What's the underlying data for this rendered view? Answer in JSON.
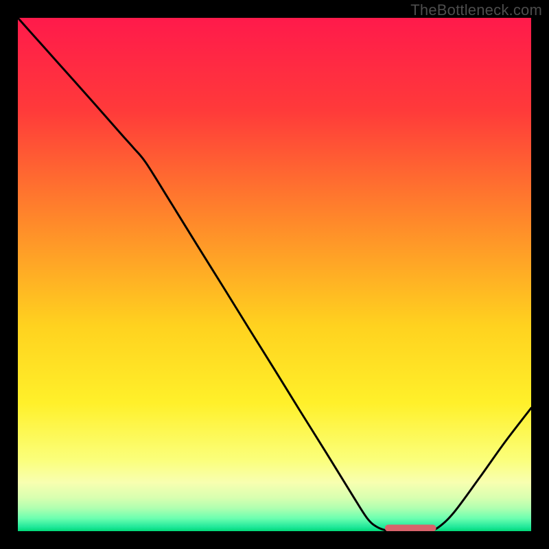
{
  "watermark": "TheBottleneck.com",
  "chart_data": {
    "type": "line",
    "title": "",
    "xlabel": "",
    "ylabel": "",
    "xlim": [
      0,
      100
    ],
    "ylim": [
      0,
      100
    ],
    "gradient_stops": [
      {
        "offset": 0.0,
        "color": "#ff1a4b"
      },
      {
        "offset": 0.18,
        "color": "#ff3a3a"
      },
      {
        "offset": 0.4,
        "color": "#ff8a2a"
      },
      {
        "offset": 0.6,
        "color": "#ffd21f"
      },
      {
        "offset": 0.75,
        "color": "#fff02a"
      },
      {
        "offset": 0.86,
        "color": "#fbff7a"
      },
      {
        "offset": 0.905,
        "color": "#f8ffb0"
      },
      {
        "offset": 0.935,
        "color": "#d8ffb0"
      },
      {
        "offset": 0.955,
        "color": "#b0ffb0"
      },
      {
        "offset": 0.975,
        "color": "#6cffb0"
      },
      {
        "offset": 0.992,
        "color": "#20e89a"
      },
      {
        "offset": 1.0,
        "color": "#00d878"
      }
    ],
    "curve_xy": [
      [
        0.0,
        100.0
      ],
      [
        5.0,
        94.4
      ],
      [
        10.0,
        88.8
      ],
      [
        15.0,
        83.2
      ],
      [
        20.0,
        77.5
      ],
      [
        22.5,
        74.7
      ],
      [
        25.0,
        71.7
      ],
      [
        30.0,
        63.7
      ],
      [
        35.0,
        55.6
      ],
      [
        40.0,
        47.6
      ],
      [
        45.0,
        39.5
      ],
      [
        50.0,
        31.5
      ],
      [
        55.0,
        23.4
      ],
      [
        60.0,
        15.4
      ],
      [
        65.0,
        7.3
      ],
      [
        68.0,
        2.6
      ],
      [
        70.0,
        0.8
      ],
      [
        72.5,
        0.0
      ],
      [
        75.0,
        0.0
      ],
      [
        78.0,
        0.0
      ],
      [
        80.0,
        0.0
      ],
      [
        82.0,
        0.8
      ],
      [
        85.0,
        3.7
      ],
      [
        90.0,
        10.5
      ],
      [
        95.0,
        17.5
      ],
      [
        100.0,
        24.0
      ]
    ],
    "optimum_marker": {
      "x_start": 71.5,
      "x_end": 81.5,
      "y": 0.6,
      "color": "#d9636b"
    }
  }
}
